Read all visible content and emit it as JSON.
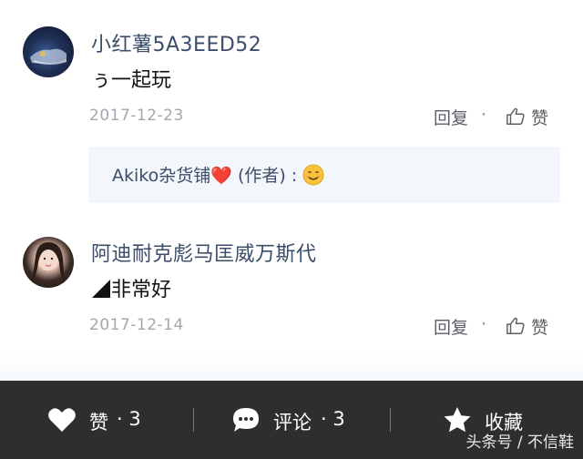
{
  "comments": [
    {
      "username": "小红薯5A3EED52",
      "text": "ぅ一起玩",
      "date": "2017-12-23",
      "reply_label": "回复",
      "dot": "·",
      "like_label": "赞"
    },
    {
      "username": "阿迪耐克彪马匡威万斯代",
      "text": "非常好",
      "date": "2017-12-14",
      "reply_label": "回复",
      "dot": "·",
      "like_label": "赞"
    }
  ],
  "author_reply": {
    "name": "Akiko杂货铺",
    "emoji": "❤️",
    "author_tag": "(作者)",
    "colon": ":",
    "smile_icon": "smiling-face-emoji"
  },
  "bottom_bar": {
    "like": {
      "label": "赞",
      "count": "· 3"
    },
    "comment": {
      "label": "评论",
      "count": "· 3"
    },
    "favorite": {
      "label": "收藏"
    }
  },
  "watermark": "头条号 / 不信鞋",
  "colors": {
    "username": "#3b4d68",
    "bar_bg": "#2e2e2e",
    "heart": "#e0302a",
    "date": "#a3a7ad"
  }
}
